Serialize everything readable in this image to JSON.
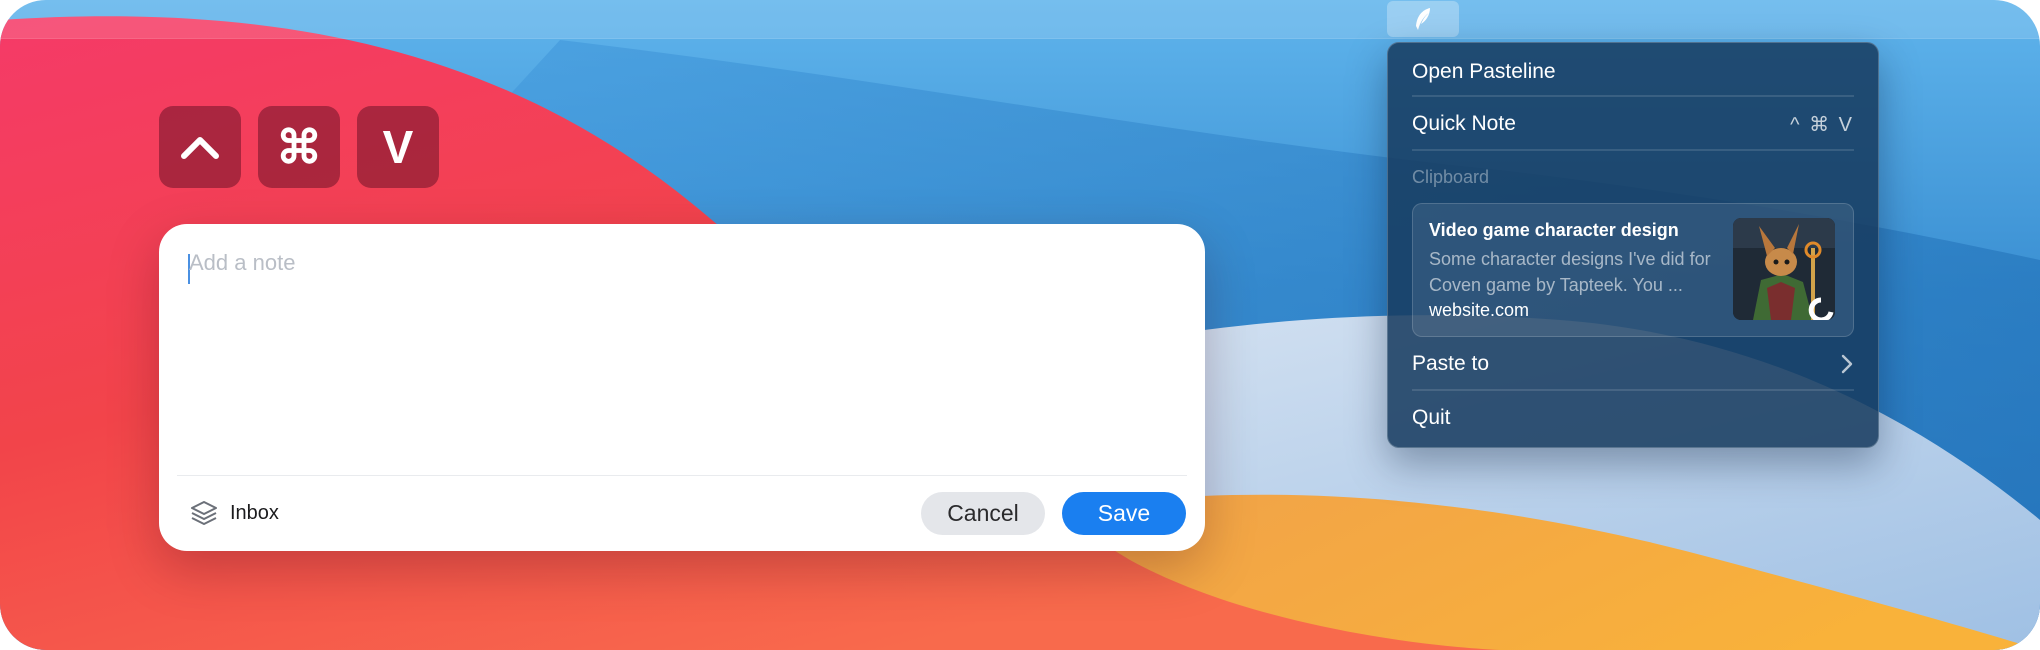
{
  "shortcut_keys": [
    {
      "name": "control",
      "symbol": "^"
    },
    {
      "name": "command",
      "symbol": "⌘"
    },
    {
      "name": "v",
      "symbol": "V"
    }
  ],
  "note_card": {
    "placeholder": "Add a note",
    "value": "",
    "inbox_label": "Inbox",
    "cancel_label": "Cancel",
    "save_label": "Save"
  },
  "menubar": {
    "app_icon": "pasteline-feather-icon"
  },
  "menu": {
    "open_label": "Open Pasteline",
    "quick_note_label": "Quick Note",
    "quick_note_shortcut": "^ ⌘ V",
    "clipboard_section": "Clipboard",
    "clip": {
      "title": "Video game character design",
      "description": "Some character designs I've did for Coven game by Tapteek. You ...",
      "source": "website.com"
    },
    "paste_to_label": "Paste to",
    "quit_label": "Quit"
  },
  "colors": {
    "accent": "#1a7ff0",
    "key_bg": "#9a2a44",
    "menu_bg": "#163a5e",
    "wall_red": "#f0384d",
    "wall_orange": "#f7a33c",
    "wall_blue": "#3a8fd2"
  },
  "icons": {
    "inbox": "layers-stack-icon",
    "paste_to_chevron": "chevron-right-icon"
  }
}
